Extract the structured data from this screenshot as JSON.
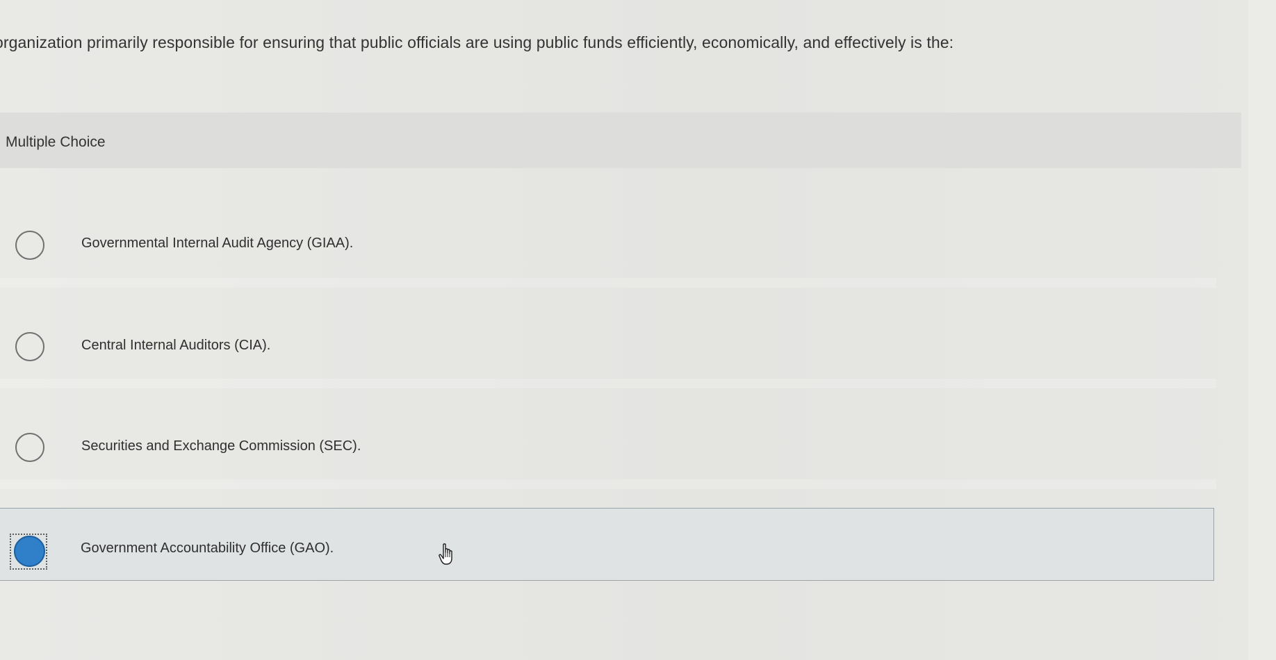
{
  "question": {
    "text": "organization primarily responsible for ensuring that public officials are using public funds efficiently, economically, and effectively is the:"
  },
  "section": {
    "label": "Multiple Choice"
  },
  "options": [
    {
      "label": "Governmental Internal Audit Agency (GIAA).",
      "selected": false
    },
    {
      "label": "Central Internal Auditors (CIA).",
      "selected": false
    },
    {
      "label": "Securities and Exchange Commission (SEC).",
      "selected": false
    },
    {
      "label": "Government Accountability Office (GAO).",
      "selected": true
    }
  ],
  "colors": {
    "selected_radio": "#2f7fc9",
    "selected_row_bg": "#dfe3e3"
  },
  "cursor": {
    "icon": "hand-pointer-icon"
  }
}
